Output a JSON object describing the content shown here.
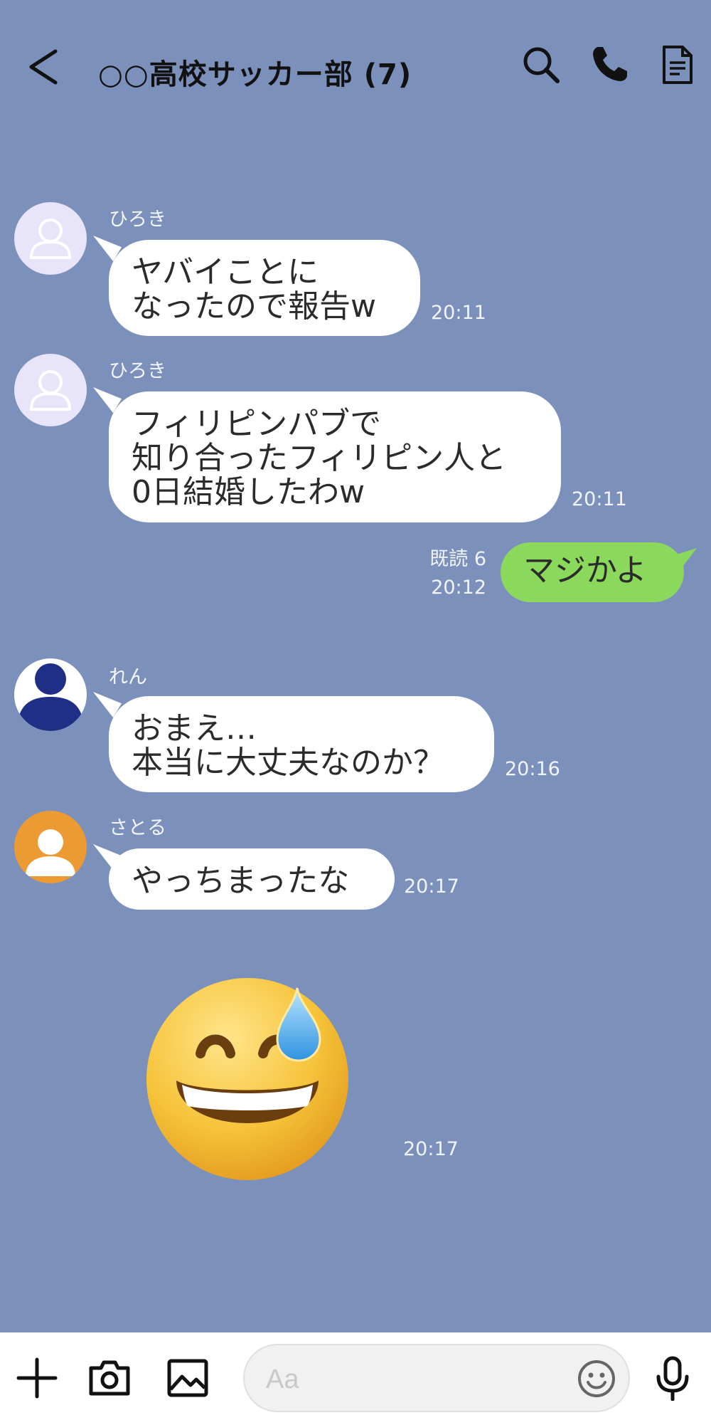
{
  "header": {
    "title": "○○高校サッカー部 (7)",
    "icons": [
      "back-arrow-icon",
      "search-icon",
      "phone-icon",
      "notes-icon"
    ]
  },
  "messages": [
    {
      "sender": "ひろき",
      "text": "ヤバイことに\nなったので報告w",
      "time": "20:11"
    },
    {
      "sender": "ひろき",
      "text": "フィリピンパブで\n知り合ったフィリピン人と\n0日結婚したわw",
      "time": "20:11"
    },
    {
      "read": "既読 6",
      "text": "マジかよ",
      "time": "20:12"
    },
    {
      "sender": "れん",
      "text": "おまえ…\n本当に大丈夫なのか？",
      "time": "20:16"
    },
    {
      "sender": "さとる",
      "text": "やっちまったな",
      "time": "20:17"
    },
    {
      "sticker": "grinning-face-with-sweat-icon",
      "time": "20:17"
    }
  ],
  "input": {
    "placeholder": "Aa"
  },
  "bottom_icons": [
    "plus-icon",
    "camera-icon",
    "image-icon",
    "emoji-icon",
    "microphone-icon"
  ],
  "colors": {
    "background": "#7b90bb",
    "outgoing_bubble": "#8ad85c",
    "incoming_bubble": "#ffffff"
  }
}
